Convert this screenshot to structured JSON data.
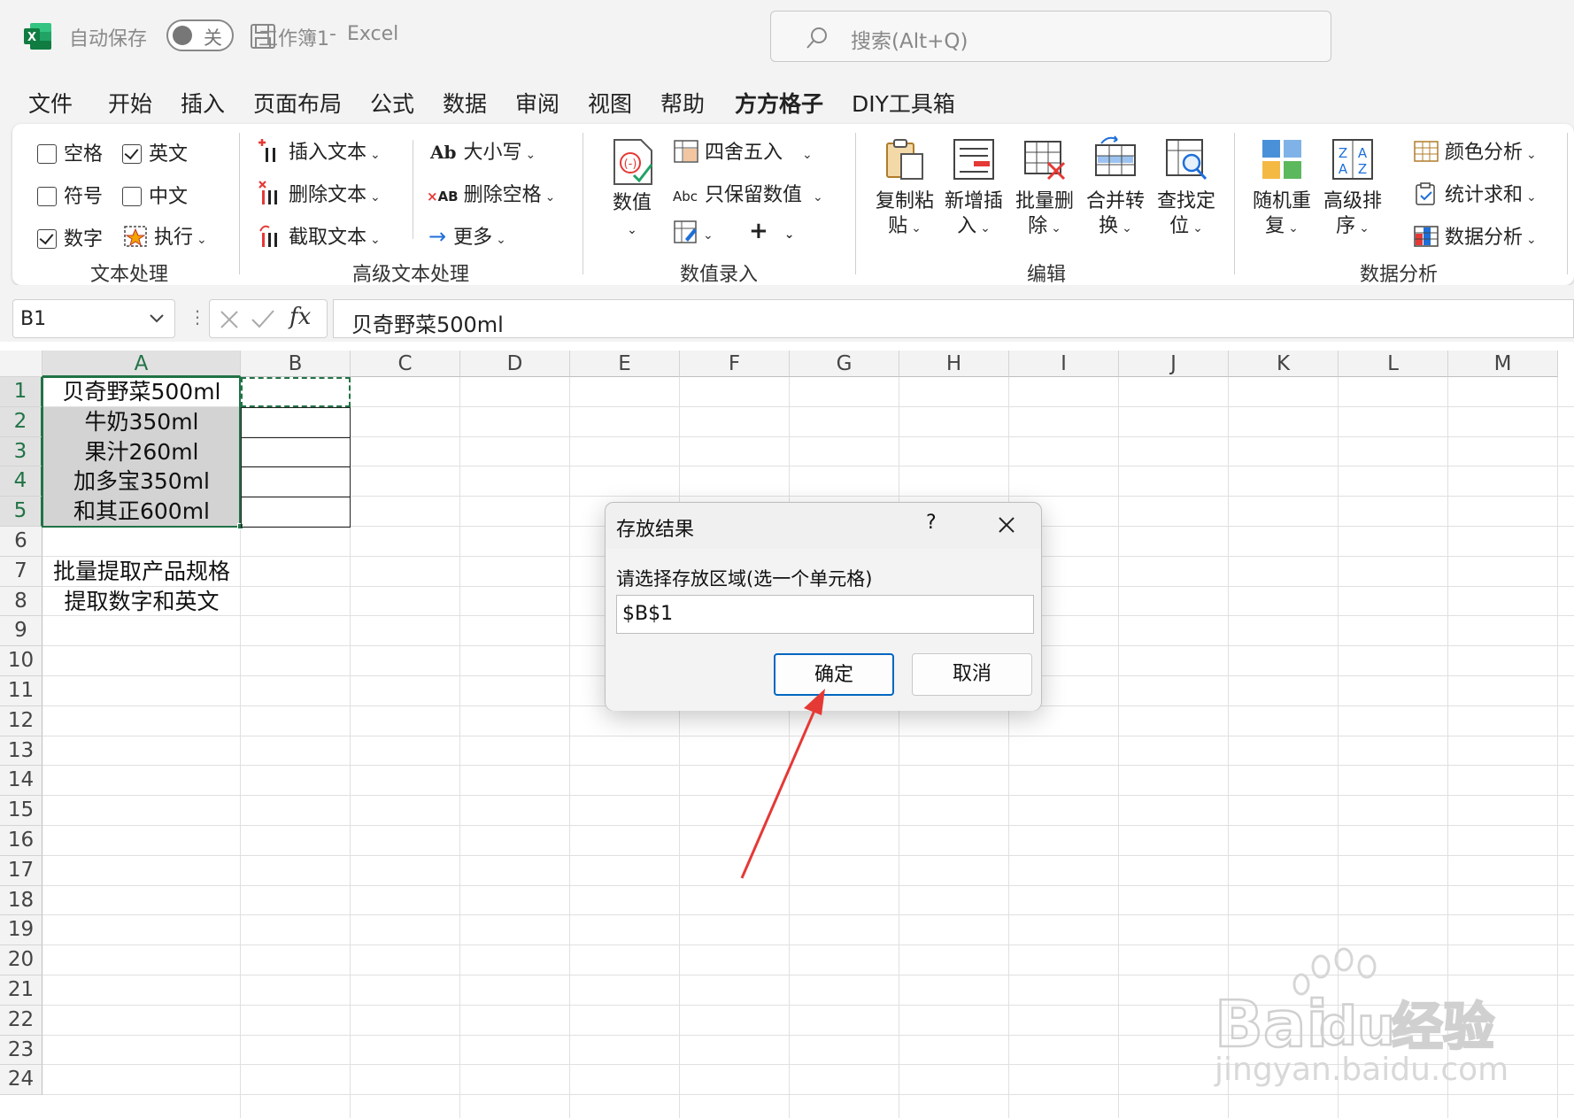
{
  "titlebar": {
    "autosave_label": "自动保存",
    "autosave_state": "关",
    "doc_title": "工作簿1",
    "separator": "-",
    "app_name": "Excel",
    "search_placeholder": "搜索(Alt+Q)"
  },
  "menu": {
    "tabs": [
      {
        "label": "文件"
      },
      {
        "label": "开始"
      },
      {
        "label": "插入"
      },
      {
        "label": "页面布局"
      },
      {
        "label": "公式"
      },
      {
        "label": "数据"
      },
      {
        "label": "审阅"
      },
      {
        "label": "视图"
      },
      {
        "label": "帮助"
      },
      {
        "label": "方方格子",
        "active": true
      },
      {
        "label": "DIY工具箱"
      }
    ]
  },
  "ribbon": {
    "text_group": {
      "label": "文本处理",
      "options": [
        {
          "label": "空格",
          "checked": false
        },
        {
          "label": "英文",
          "checked": true
        },
        {
          "label": "符号",
          "checked": false
        },
        {
          "label": "中文",
          "checked": false
        },
        {
          "label": "数字",
          "checked": true
        }
      ],
      "execute": "执行"
    },
    "adv_group": {
      "label": "高级文本处理",
      "items": [
        "插入文本",
        "删除文本",
        "截取文本",
        "大小写",
        "删除空格",
        "更多"
      ],
      "icon_text_case": "Ab",
      "icon_text_space": "AB"
    },
    "num_group": {
      "label": "数值录入",
      "value_btn": "数值",
      "round_btn": "四舍五入",
      "keep_btn": "只保留数值",
      "keep_icon_text": "Abc"
    },
    "edit_group": {
      "label": "编辑",
      "buttons": [
        {
          "l1": "复制粘",
          "l2": "贴"
        },
        {
          "l1": "新增插",
          "l2": "入"
        },
        {
          "l1": "批量删",
          "l2": "除"
        },
        {
          "l1": "合并转",
          "l2": "换"
        },
        {
          "l1": "查找定",
          "l2": "位"
        }
      ]
    },
    "analysis_group": {
      "label": "数据分析",
      "buttons": [
        {
          "l1": "随机重",
          "l2": "复"
        },
        {
          "l1": "高级排",
          "l2": "序"
        }
      ],
      "side": [
        "颜色分析",
        "统计求和",
        "数据分析"
      ]
    }
  },
  "formula_bar": {
    "name_box": "B1",
    "fx": "fx",
    "formula": "贝奇野菜500ml"
  },
  "sheet": {
    "columns": [
      "A",
      "B",
      "C",
      "D",
      "E",
      "F",
      "G",
      "H",
      "I",
      "J",
      "K",
      "L",
      "M"
    ],
    "rows": [
      "1",
      "2",
      "3",
      "4",
      "5",
      "6",
      "7",
      "8",
      "9",
      "10",
      "11",
      "12",
      "13",
      "14",
      "15",
      "16",
      "17",
      "18",
      "19",
      "20",
      "21",
      "22",
      "23",
      "24"
    ],
    "cells": {
      "a1": "贝奇野菜500ml",
      "a2": "牛奶350ml",
      "a3": "果汁260ml",
      "a4": "加多宝350ml",
      "a5": "和其正600ml",
      "a7": "批量提取产品规格",
      "a8": "提取数字和英文"
    }
  },
  "dialog": {
    "title": "存放结果",
    "help": "?",
    "prompt": "请选择存放区域(选一个单元格)",
    "value": "$B$1",
    "ok": "确定",
    "cancel": "取消"
  },
  "watermark": {
    "brand": "Bai",
    "brand2": "du",
    "cn": "经验",
    "domain": "jingyan.baidu.com"
  },
  "colors": {
    "excel_green": "#217346",
    "selection_fill": "#d3d3d3",
    "dialog_primary_border": "#0067c0",
    "annotation_arrow": "#e53935"
  }
}
